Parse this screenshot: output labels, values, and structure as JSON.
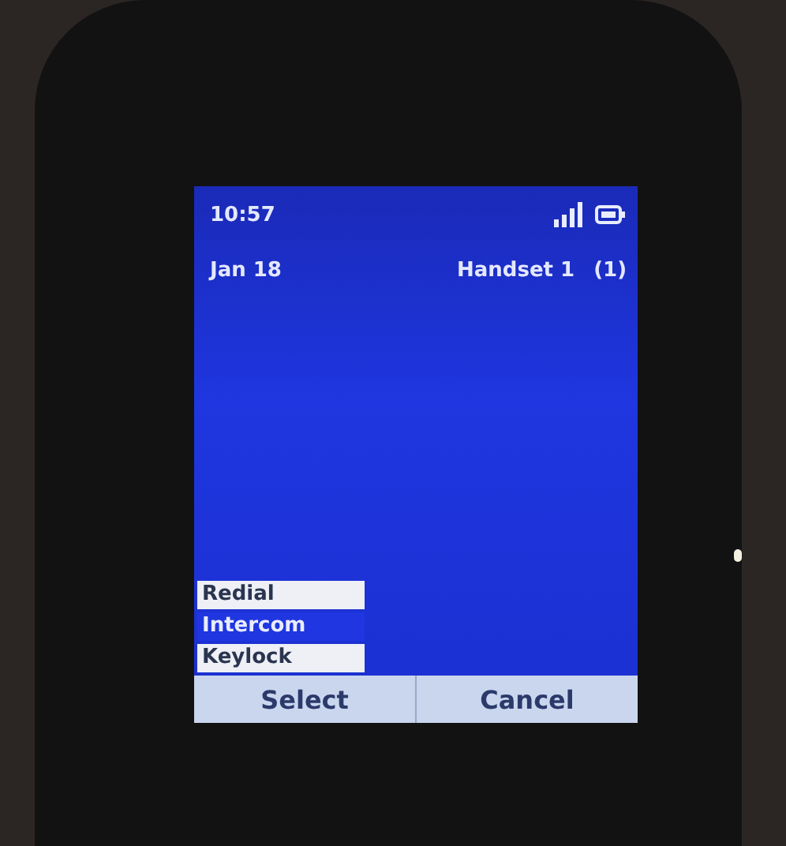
{
  "status_bar": {
    "time": "10:57"
  },
  "info": {
    "date": "Jan 18",
    "handset": "Handset 1",
    "count": "(1)"
  },
  "menu": [
    {
      "label": "Redial",
      "selected": false
    },
    {
      "label": "Intercom",
      "selected": true
    },
    {
      "label": "Keylock",
      "selected": false
    }
  ],
  "softkeys": [
    "Select",
    "Cancel"
  ]
}
